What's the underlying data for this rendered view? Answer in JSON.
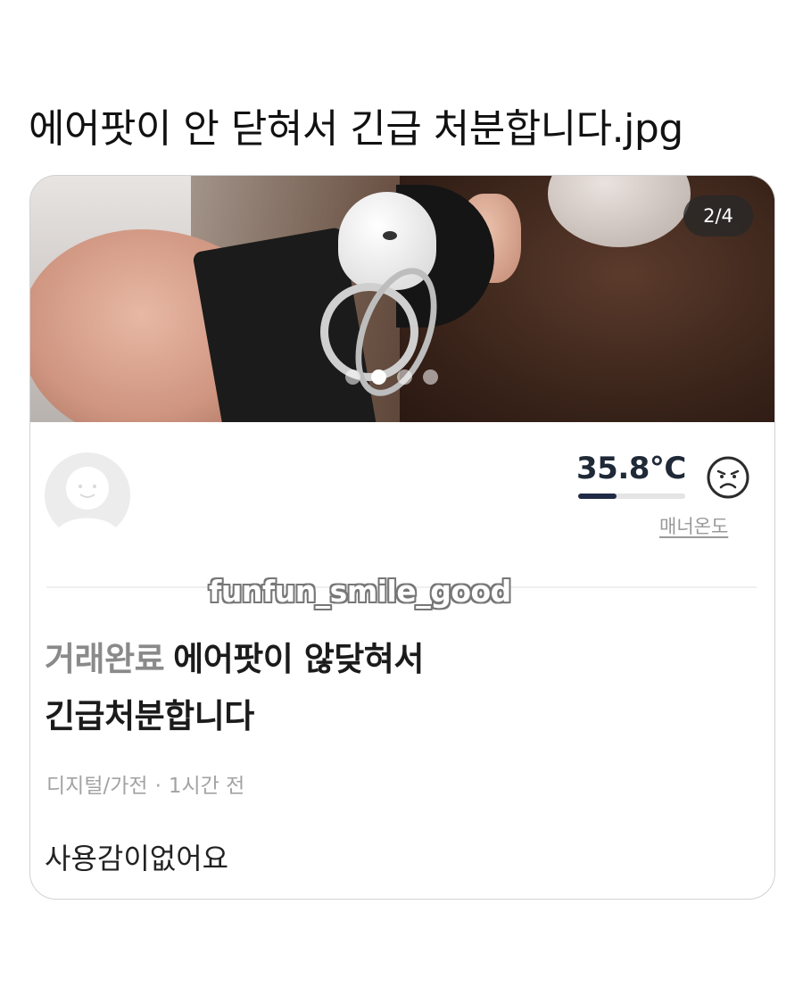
{
  "post": {
    "title": "에어팟이 안 닫혀서 긴급 처분합니다.jpg"
  },
  "listing": {
    "image_counter": "2/4",
    "carousel": {
      "total": 4,
      "current": 2
    },
    "seller": {
      "manner_temp": "35.8°C",
      "manner_temp_value": 35.8,
      "manner_label": "매너온도",
      "mood_icon": "frowning-face-icon"
    },
    "watermark": "funfun_smile_good",
    "status_label": "거래완료",
    "title_line1": "에어팟이 않닺혀서",
    "title_line2": "긴급처분합니다",
    "category": "디지털/가전",
    "separator": "·",
    "time_ago": "1시간 전",
    "description": "사용감이없어요"
  },
  "colors": {
    "temp_fill": "#1f2a44",
    "status_gray": "#8a8a8a",
    "meta_gray": "#a3a3a3"
  }
}
